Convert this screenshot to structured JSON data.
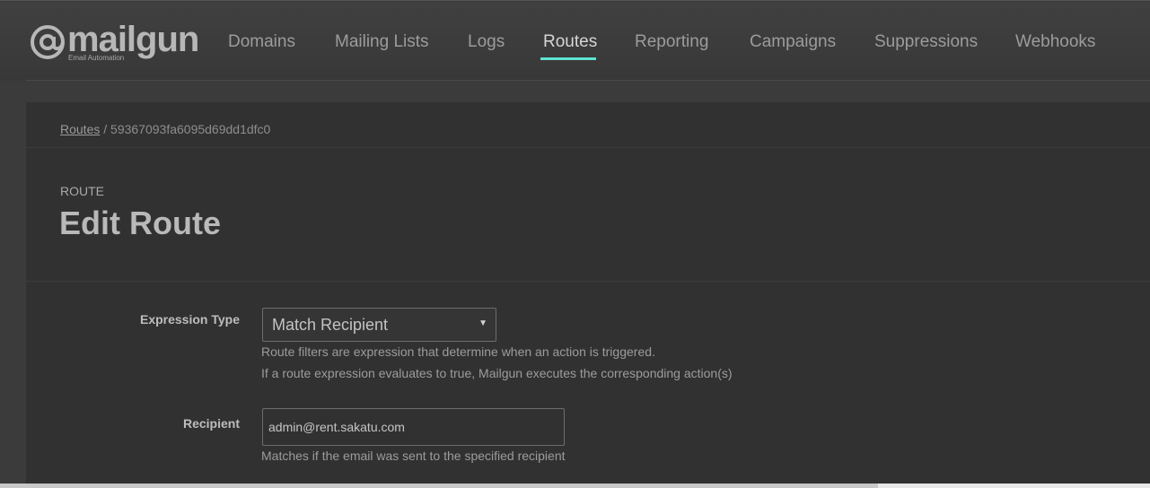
{
  "brand": {
    "name": "mailgun",
    "tagline": "Email Automation"
  },
  "nav": {
    "items": [
      {
        "label": "Domains"
      },
      {
        "label": "Mailing Lists"
      },
      {
        "label": "Logs"
      },
      {
        "label": "Routes",
        "active": true
      },
      {
        "label": "Reporting"
      },
      {
        "label": "Campaigns"
      },
      {
        "label": "Suppressions"
      },
      {
        "label": "Webhooks"
      }
    ],
    "accent_color": "#5ee3d0"
  },
  "breadcrumb": {
    "parent": "Routes",
    "separator": "/",
    "current": "59367093fa6095d69dd1dfc0"
  },
  "header": {
    "eyebrow": "ROUTE",
    "title": "Edit Route"
  },
  "form": {
    "expression_type": {
      "label": "Expression Type",
      "value": "Match Recipient",
      "help_1": "Route filters are expression that determine when an action is triggered.",
      "help_2": "If a route expression evaluates to true, Mailgun executes the corresponding action(s)"
    },
    "recipient": {
      "label": "Recipient",
      "value": "admin@rent.sakatu.com",
      "help": "Matches if the email was sent to the specified recipient"
    }
  }
}
